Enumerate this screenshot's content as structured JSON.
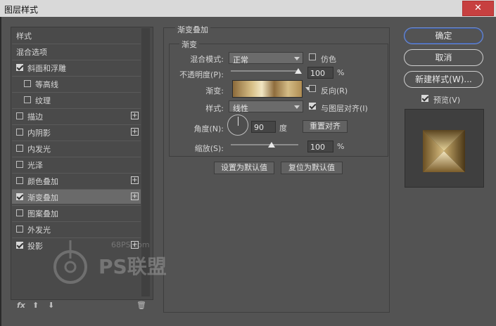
{
  "window": {
    "title": "图层样式",
    "close_glyph": "✕"
  },
  "left_list": {
    "items": [
      {
        "label": "样式",
        "checkbox": false,
        "checked": false,
        "indent": false,
        "plus": false,
        "selected": false
      },
      {
        "label": "混合选项",
        "checkbox": false,
        "checked": false,
        "indent": false,
        "plus": false,
        "selected": false
      },
      {
        "label": "斜面和浮雕",
        "checkbox": true,
        "checked": true,
        "indent": false,
        "plus": false,
        "selected": false
      },
      {
        "label": "等高线",
        "checkbox": true,
        "checked": false,
        "indent": true,
        "plus": false,
        "selected": false
      },
      {
        "label": "纹理",
        "checkbox": true,
        "checked": false,
        "indent": true,
        "plus": false,
        "selected": false
      },
      {
        "label": "描边",
        "checkbox": true,
        "checked": false,
        "indent": false,
        "plus": true,
        "selected": false
      },
      {
        "label": "内阴影",
        "checkbox": true,
        "checked": false,
        "indent": false,
        "plus": true,
        "selected": false
      },
      {
        "label": "内发光",
        "checkbox": true,
        "checked": false,
        "indent": false,
        "plus": false,
        "selected": false
      },
      {
        "label": "光泽",
        "checkbox": true,
        "checked": false,
        "indent": false,
        "plus": false,
        "selected": false
      },
      {
        "label": "颜色叠加",
        "checkbox": true,
        "checked": false,
        "indent": false,
        "plus": true,
        "selected": false
      },
      {
        "label": "渐变叠加",
        "checkbox": true,
        "checked": true,
        "indent": false,
        "plus": true,
        "selected": true
      },
      {
        "label": "图案叠加",
        "checkbox": true,
        "checked": false,
        "indent": false,
        "plus": false,
        "selected": false
      },
      {
        "label": "外发光",
        "checkbox": true,
        "checked": false,
        "indent": false,
        "plus": false,
        "selected": false
      },
      {
        "label": "投影",
        "checkbox": true,
        "checked": true,
        "indent": false,
        "plus": true,
        "selected": false
      }
    ],
    "footer": {
      "fx": "fx",
      "up": "⬆",
      "down": "⬇",
      "trash": "🗑"
    }
  },
  "gradient_overlay": {
    "group_title": "渐变叠加",
    "sub_title": "渐变",
    "blend_mode": {
      "label": "混合模式:",
      "value": "正常"
    },
    "dither": {
      "label": "仿色",
      "checked": false
    },
    "opacity": {
      "label": "不透明度(P):",
      "value": "100",
      "unit": "%",
      "level": 1.0
    },
    "gradient": {
      "label": "渐变:",
      "colors": [
        "#8c6a3a",
        "#d9c189",
        "#f1e6c3",
        "#8f6d3d",
        "#d4bc86",
        "#b08d53"
      ]
    },
    "reverse": {
      "label": "反向(R)",
      "checked": false
    },
    "style": {
      "label": "样式:",
      "value": "线性"
    },
    "align": {
      "label": "与图层对齐(I)",
      "checked": true
    },
    "angle": {
      "label": "角度(N):",
      "value": "90",
      "unit": "度"
    },
    "reset_align_button": "重置对齐",
    "scale": {
      "label": "缩放(S):",
      "value": "100",
      "unit": "%",
      "level": 0.5
    },
    "set_default_button": "设置为默认值",
    "reset_default_button": "复位为默认值"
  },
  "right": {
    "ok_button": "确定",
    "cancel_button": "取消",
    "new_style_button": "新建样式(W)...",
    "preview": {
      "label": "预览(V)",
      "checked": true
    }
  },
  "watermark": {
    "site": "68PS.com",
    "brand": "PS联盟"
  },
  "colors": {
    "accent": "#6f8fd8",
    "panel": "#535353",
    "list_bg": "#4a4a4a",
    "selected_row": "#6a6a6a"
  }
}
